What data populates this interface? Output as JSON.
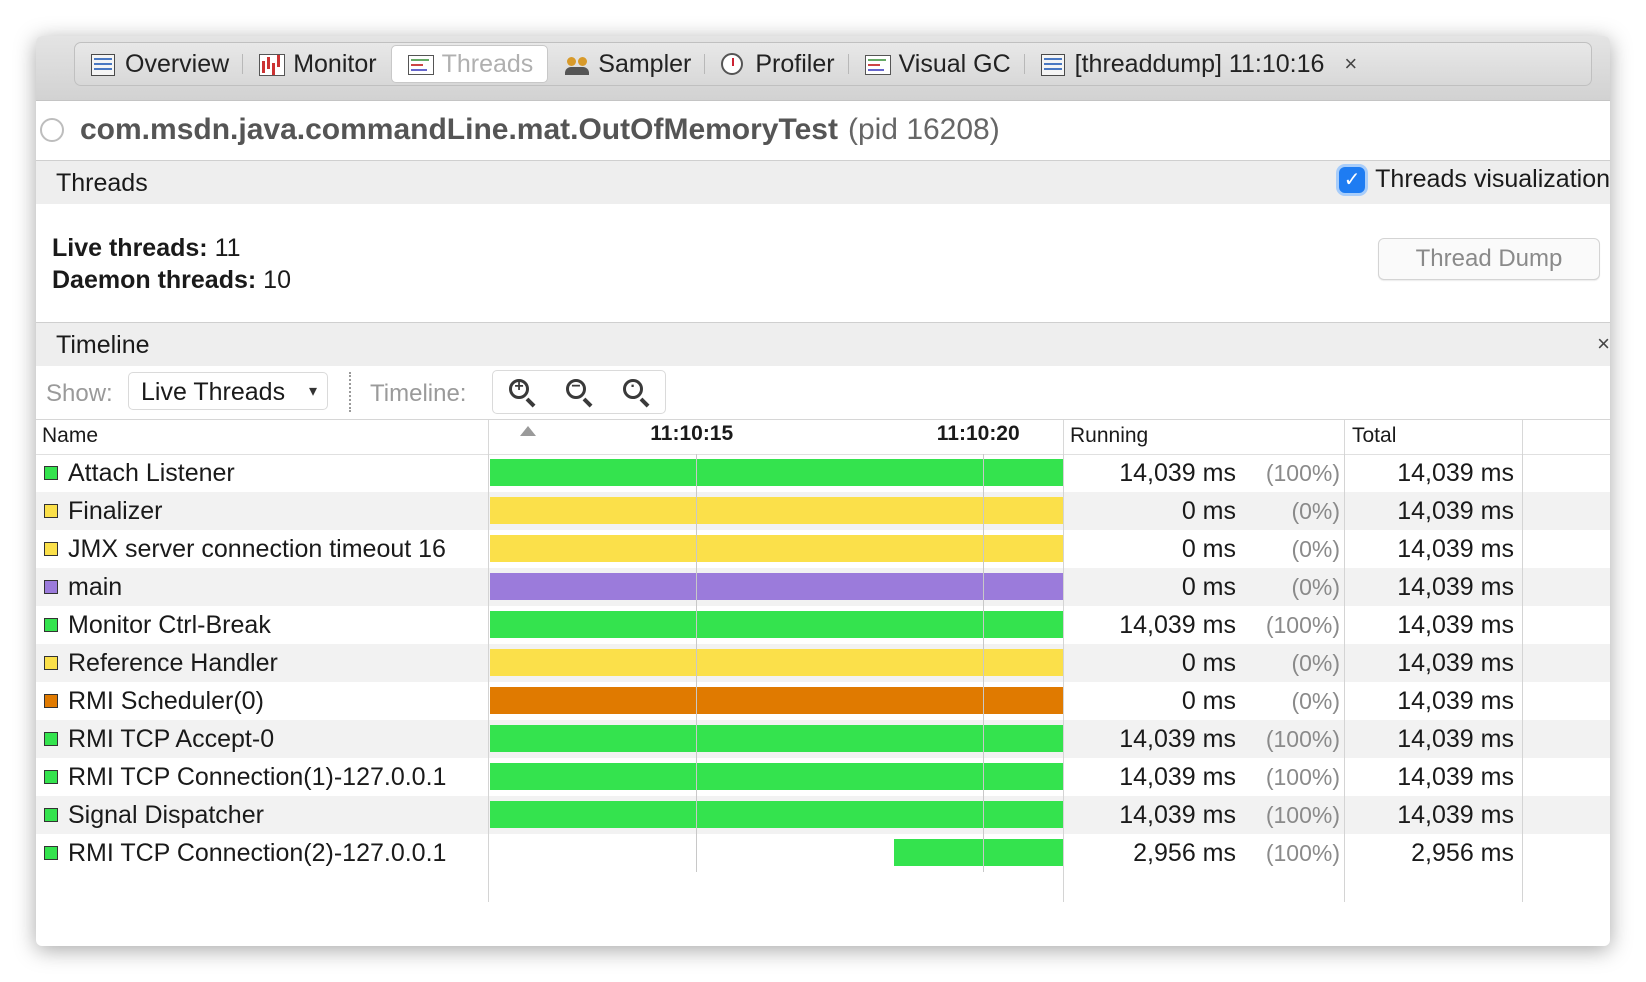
{
  "tabs": [
    {
      "label": "Overview",
      "icon": "overview-icon",
      "active": false
    },
    {
      "label": "Monitor",
      "icon": "monitor-icon",
      "active": false
    },
    {
      "label": "Threads",
      "icon": "threads-icon",
      "active": true
    },
    {
      "label": "Sampler",
      "icon": "sampler-icon",
      "active": false
    },
    {
      "label": "Profiler",
      "icon": "profiler-icon",
      "active": false
    },
    {
      "label": "Visual GC",
      "icon": "visual-gc-icon",
      "active": false
    },
    {
      "label": "[threaddump] 11:10:16",
      "icon": "threaddump-icon",
      "active": false,
      "closable": true
    }
  ],
  "tab_close_glyph": "×",
  "process": {
    "name": "com.msdn.java.commandLine.mat.OutOfMemoryTest",
    "pid": "(pid 16208)"
  },
  "threads_section": {
    "title": "Threads",
    "visualization_label": "Threads visualization",
    "visualization_checked": true,
    "live_label": "Live threads:",
    "live_value": "11",
    "daemon_label": "Daemon threads:",
    "daemon_value": "10",
    "dump_button": "Thread Dump"
  },
  "timeline_section": {
    "title": "Timeline",
    "close_glyph": "×",
    "show_label": "Show:",
    "show_value": "Live Threads",
    "timeline_label": "Timeline:",
    "zoom_buttons": [
      "zoom-in",
      "zoom-out",
      "zoom-fit"
    ]
  },
  "table": {
    "headers": {
      "name": "Name",
      "running": "Running",
      "total": "Total"
    },
    "ticks": [
      "11:10:15",
      "11:10:20"
    ]
  },
  "colors": {
    "running": "#34e34e",
    "wait": "#fbe04a",
    "sleeping": "#9b7bdb",
    "park": "#e07a00"
  },
  "chart_data": {
    "type": "table",
    "rows": [
      {
        "name": "Attach Listener",
        "state": "running",
        "start": 0.0,
        "end": 1.0,
        "running": "14,039 ms",
        "pct": "(100%)",
        "total": "14,039 ms"
      },
      {
        "name": "Finalizer",
        "state": "wait",
        "start": 0.0,
        "end": 1.0,
        "running": "0 ms",
        "pct": "(0%)",
        "total": "14,039 ms"
      },
      {
        "name": "JMX server connection timeout 16",
        "state": "wait",
        "start": 0.0,
        "end": 1.0,
        "running": "0 ms",
        "pct": "(0%)",
        "total": "14,039 ms"
      },
      {
        "name": "main",
        "state": "sleeping",
        "start": 0.0,
        "end": 1.0,
        "running": "0 ms",
        "pct": "(0%)",
        "total": "14,039 ms"
      },
      {
        "name": "Monitor Ctrl-Break",
        "state": "running",
        "start": 0.0,
        "end": 1.0,
        "running": "14,039 ms",
        "pct": "(100%)",
        "total": "14,039 ms"
      },
      {
        "name": "Reference Handler",
        "state": "wait",
        "start": 0.0,
        "end": 1.0,
        "running": "0 ms",
        "pct": "(0%)",
        "total": "14,039 ms"
      },
      {
        "name": "RMI Scheduler(0)",
        "state": "park",
        "start": 0.0,
        "end": 1.0,
        "running": "0 ms",
        "pct": "(0%)",
        "total": "14,039 ms"
      },
      {
        "name": "RMI TCP Accept-0",
        "state": "running",
        "start": 0.0,
        "end": 1.0,
        "running": "14,039 ms",
        "pct": "(100%)",
        "total": "14,039 ms"
      },
      {
        "name": "RMI TCP Connection(1)-127.0.0.1",
        "state": "running",
        "start": 0.0,
        "end": 1.0,
        "running": "14,039 ms",
        "pct": "(100%)",
        "total": "14,039 ms"
      },
      {
        "name": "Signal Dispatcher",
        "state": "running",
        "start": 0.0,
        "end": 1.0,
        "running": "14,039 ms",
        "pct": "(100%)",
        "total": "14,039 ms"
      },
      {
        "name": "RMI TCP Connection(2)-127.0.0.1",
        "state": "running",
        "start": 0.705,
        "end": 1.0,
        "running": "2,956 ms",
        "pct": "(100%)",
        "total": "2,956 ms"
      }
    ]
  }
}
